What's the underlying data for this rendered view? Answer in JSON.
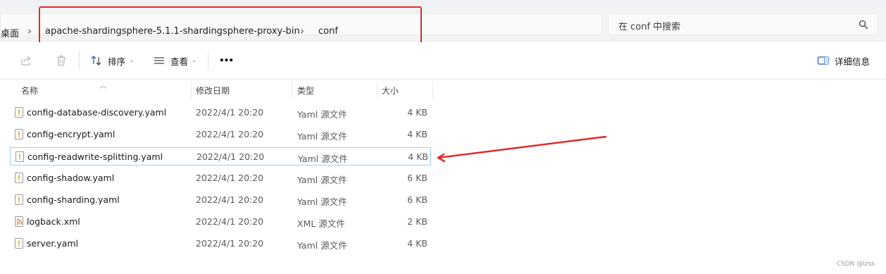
{
  "address": {
    "crumbs": [
      "桌面",
      "apache-shardingsphere-5.1.1-shardingsphere-proxy-bin",
      "conf"
    ],
    "search_placeholder": "在 conf 中搜索"
  },
  "toolbar": {
    "sort_label": "排序",
    "view_label": "查看",
    "more_label": "•••",
    "details_label": "详细信息"
  },
  "columns": {
    "name": "名称",
    "modified": "修改日期",
    "type": "类型",
    "size": "大小"
  },
  "files": [
    {
      "name": "config-database-discovery.yaml",
      "modified": "2022/4/1 20:20",
      "type": "Yaml 源文件",
      "size": "4 KB",
      "icon": "yaml-file-icon"
    },
    {
      "name": "config-encrypt.yaml",
      "modified": "2022/4/1 20:20",
      "type": "Yaml 源文件",
      "size": "4 KB",
      "icon": "yaml-file-icon"
    },
    {
      "name": "config-readwrite-splitting.yaml",
      "modified": "2022/4/1 20:20",
      "type": "Yaml 源文件",
      "size": "4 KB",
      "icon": "yaml-file-icon",
      "selected": true
    },
    {
      "name": "config-shadow.yaml",
      "modified": "2022/4/1 20:20",
      "type": "Yaml 源文件",
      "size": "6 KB",
      "icon": "yaml-file-icon"
    },
    {
      "name": "config-sharding.yaml",
      "modified": "2022/4/1 20:20",
      "type": "Yaml 源文件",
      "size": "6 KB",
      "icon": "yaml-file-icon"
    },
    {
      "name": "logback.xml",
      "modified": "2022/4/1 20:20",
      "type": "XML 源文件",
      "size": "2 KB",
      "icon": "xml-file-icon"
    },
    {
      "name": "server.yaml",
      "modified": "2022/4/1 20:20",
      "type": "Yaml 源文件",
      "size": "4 KB",
      "icon": "yaml-file-icon"
    }
  ],
  "watermark": "CSDN @lzss",
  "colors": {
    "annotation_red": "#e02b2b",
    "selection_border": "#99d1ff"
  }
}
